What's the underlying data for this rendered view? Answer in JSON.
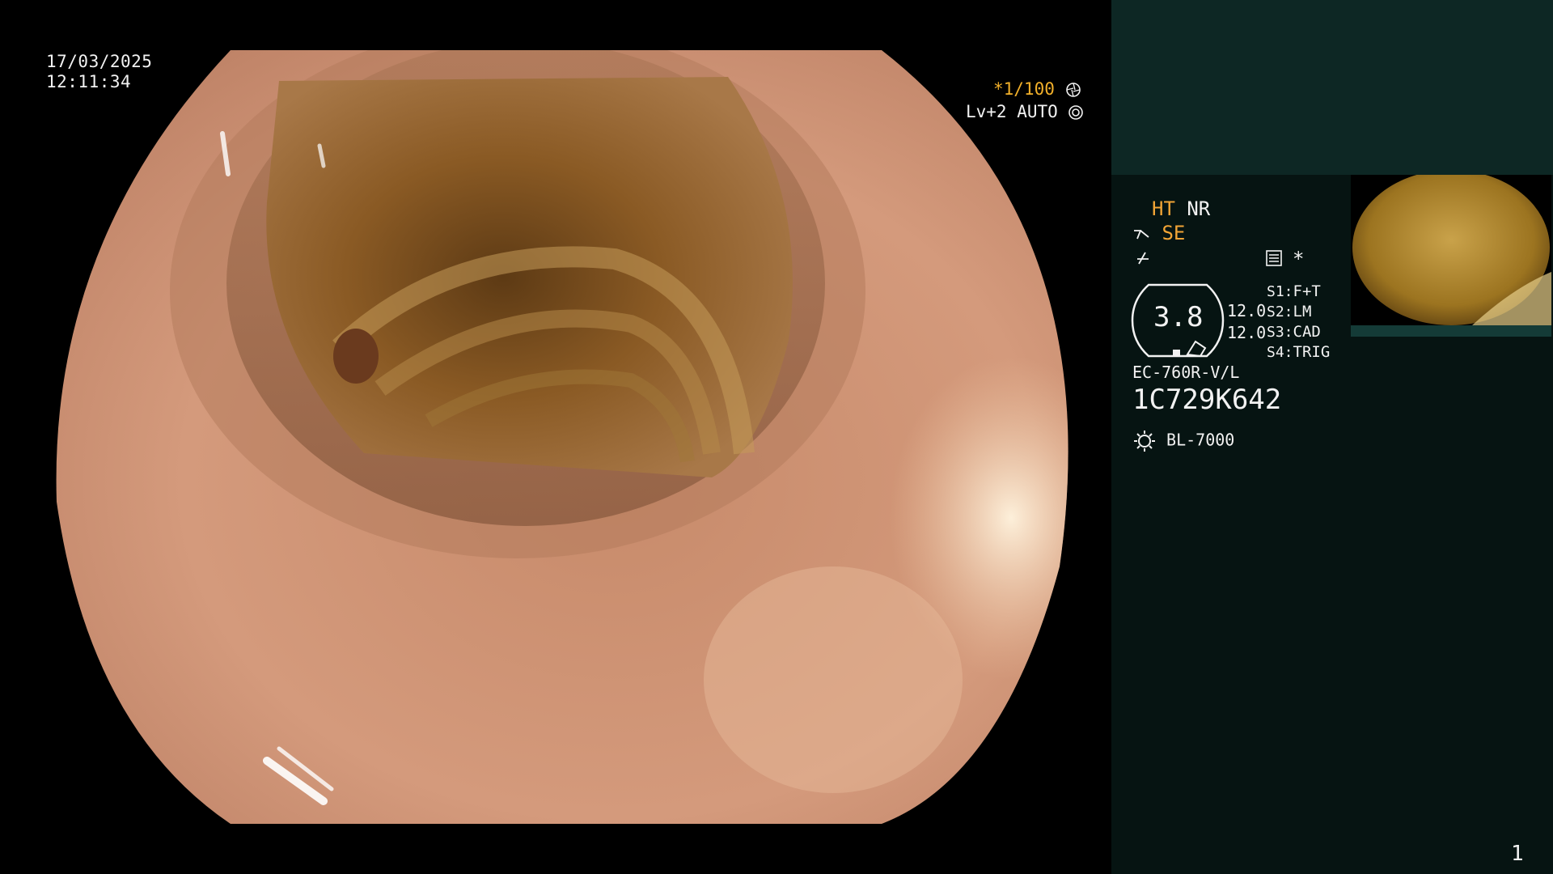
{
  "overlay": {
    "date": "17/03/2025",
    "time": "12:11:34",
    "shutter": "*1/100",
    "level": "Lv+2",
    "mode": "AUTO"
  },
  "panel": {
    "ht": "HT",
    "nr": "NR",
    "se": "SE",
    "zoom_value": "3.8",
    "val_a": "12.0",
    "val_b": "12.0",
    "switches": [
      {
        "key": "S1:",
        "value": "F+T"
      },
      {
        "key": "S2:",
        "value": "LM"
      },
      {
        "key": "S3:",
        "value": "CAD"
      },
      {
        "key": "S4:",
        "value": "TRIG"
      }
    ],
    "asterisk": "*",
    "scope_model": "EC-760R-V/L",
    "serial": "1C729K642",
    "light_source": "BL-7000",
    "page_number": "1"
  },
  "colors": {
    "accent_orange": "#f2a536",
    "panel_top": "#0d2724",
    "panel_body": "#061412"
  },
  "icons": [
    "aperture-icon",
    "iris-icon",
    "scope-tip-icon",
    "freeze-icon",
    "settings-list-icon",
    "lamp-icon"
  ]
}
